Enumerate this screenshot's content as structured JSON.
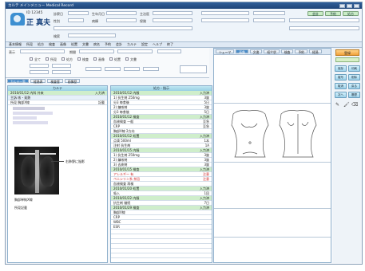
{
  "app": {
    "title": "カルテ メインメニュー  Medical Record",
    "patient_id": "ID 12345",
    "patient_name": "正 真夫"
  },
  "header": {
    "labels": [
      "診察日",
      "生年月日",
      "性別",
      "病棟",
      "主治医",
      "保険"
    ],
    "search_label": "検索",
    "status_buttons": [
      "会計",
      "予約",
      "処方"
    ]
  },
  "menubar": {
    "items": [
      "基本情報",
      "所見",
      "処方",
      "検査",
      "画像",
      "処置",
      "文書",
      "病名",
      "予約",
      "会計",
      "カルテ",
      "設定",
      "ヘルプ",
      "終了"
    ]
  },
  "filter": {
    "label1": "表示",
    "label2": "期間",
    "options": [
      "全て",
      "所見",
      "処方",
      "検査",
      "画像",
      "処置",
      "文書"
    ],
    "tabs": [
      "カルテ一覧",
      "経過表",
      "検査歴",
      "画像歴"
    ]
  },
  "left_panel": {
    "header": "カルテ",
    "rows": [
      {
        "text": "2010/01/12 内科 外来",
        "tag": "入力済"
      },
      {
        "text": "主訴  咳・発熱",
        "tag": ""
      },
      {
        "text": "所見  胸部X線",
        "tag": "記載"
      }
    ],
    "annotation": "右肺野に陰影",
    "caption": "胸部単純X線",
    "footer": "所見記載"
  },
  "middle_panel": {
    "header": "処方・指示",
    "rows": [
      {
        "text": "2010/01/12 内服",
        "tag": "入力済",
        "type": "g"
      },
      {
        "text": "1) 抗生剤 250mg",
        "tag": "3錠",
        "type": ""
      },
      {
        "text": "   分3 毎食後",
        "tag": "5日",
        "type": ""
      },
      {
        "text": "2) 鎮咳剤",
        "tag": "3錠",
        "type": ""
      },
      {
        "text": "   分3 毎食後",
        "tag": "5日",
        "type": ""
      },
      {
        "text": "2010/01/12 検査",
        "tag": "入力済",
        "type": "g"
      },
      {
        "text": "血液検査 一般",
        "tag": "至急",
        "type": ""
      },
      {
        "text": "CRP",
        "tag": "至急",
        "type": ""
      },
      {
        "text": "胸部X線 2方向",
        "tag": "",
        "type": ""
      },
      {
        "text": "2010/01/12 処置",
        "tag": "入力済",
        "type": "g"
      },
      {
        "text": "点滴 500ml",
        "tag": "1本",
        "type": ""
      },
      {
        "text": "注射 抗生剤",
        "tag": "1A",
        "type": ""
      },
      {
        "text": "2010/01/15 内服",
        "tag": "入力済",
        "type": "g"
      },
      {
        "text": "1) 抗生剤 250mg",
        "tag": "3錠",
        "type": ""
      },
      {
        "text": "2) 鎮咳剤",
        "tag": "3錠",
        "type": ""
      },
      {
        "text": "3) 去痰剤",
        "tag": "3錠",
        "type": ""
      },
      {
        "text": "2010/01/15 検査",
        "tag": "入力済",
        "type": "g"
      },
      {
        "text": "アレルギー 有",
        "tag": "注意",
        "type": "r"
      },
      {
        "text": "ペニシリン系 禁忌",
        "tag": "注意",
        "type": "r"
      },
      {
        "text": "血液検査 再検",
        "tag": "",
        "type": ""
      },
      {
        "text": "2010/01/20 処置",
        "tag": "入力済",
        "type": "g"
      },
      {
        "text": "吸入",
        "tag": "1回",
        "type": ""
      },
      {
        "text": "2010/01/22 内服",
        "tag": "入力済",
        "type": "g"
      },
      {
        "text": "抗生剤 継続",
        "tag": "7日",
        "type": ""
      },
      {
        "text": "2010/01/29 検査",
        "tag": "入力済",
        "type": "g"
      },
      {
        "text": "胸部X線",
        "tag": "",
        "type": ""
      },
      {
        "text": "CRP",
        "tag": "",
        "type": ""
      },
      {
        "text": "WBC",
        "tag": "",
        "type": ""
      },
      {
        "text": "ESR",
        "tag": "",
        "type": ""
      },
      {
        "text": "",
        "tag": "",
        "type": ""
      },
      {
        "text": "",
        "tag": "",
        "type": ""
      },
      {
        "text": "",
        "tag": "",
        "type": ""
      },
      {
        "text": "",
        "tag": "",
        "type": ""
      },
      {
        "text": "",
        "tag": "",
        "type": ""
      },
      {
        "text": "",
        "tag": "",
        "type": ""
      },
      {
        "text": "",
        "tag": "",
        "type": ""
      }
    ]
  },
  "right_panel": {
    "tabs": [
      "シェーマ",
      "画像",
      "文書",
      "紹介状",
      "検査",
      "予約",
      "経過"
    ]
  },
  "side": {
    "main_button": "登録",
    "tools": [
      "保存",
      "印刷",
      "複写",
      "削除",
      "取消",
      "戻る",
      "次へ",
      "履歴"
    ]
  }
}
